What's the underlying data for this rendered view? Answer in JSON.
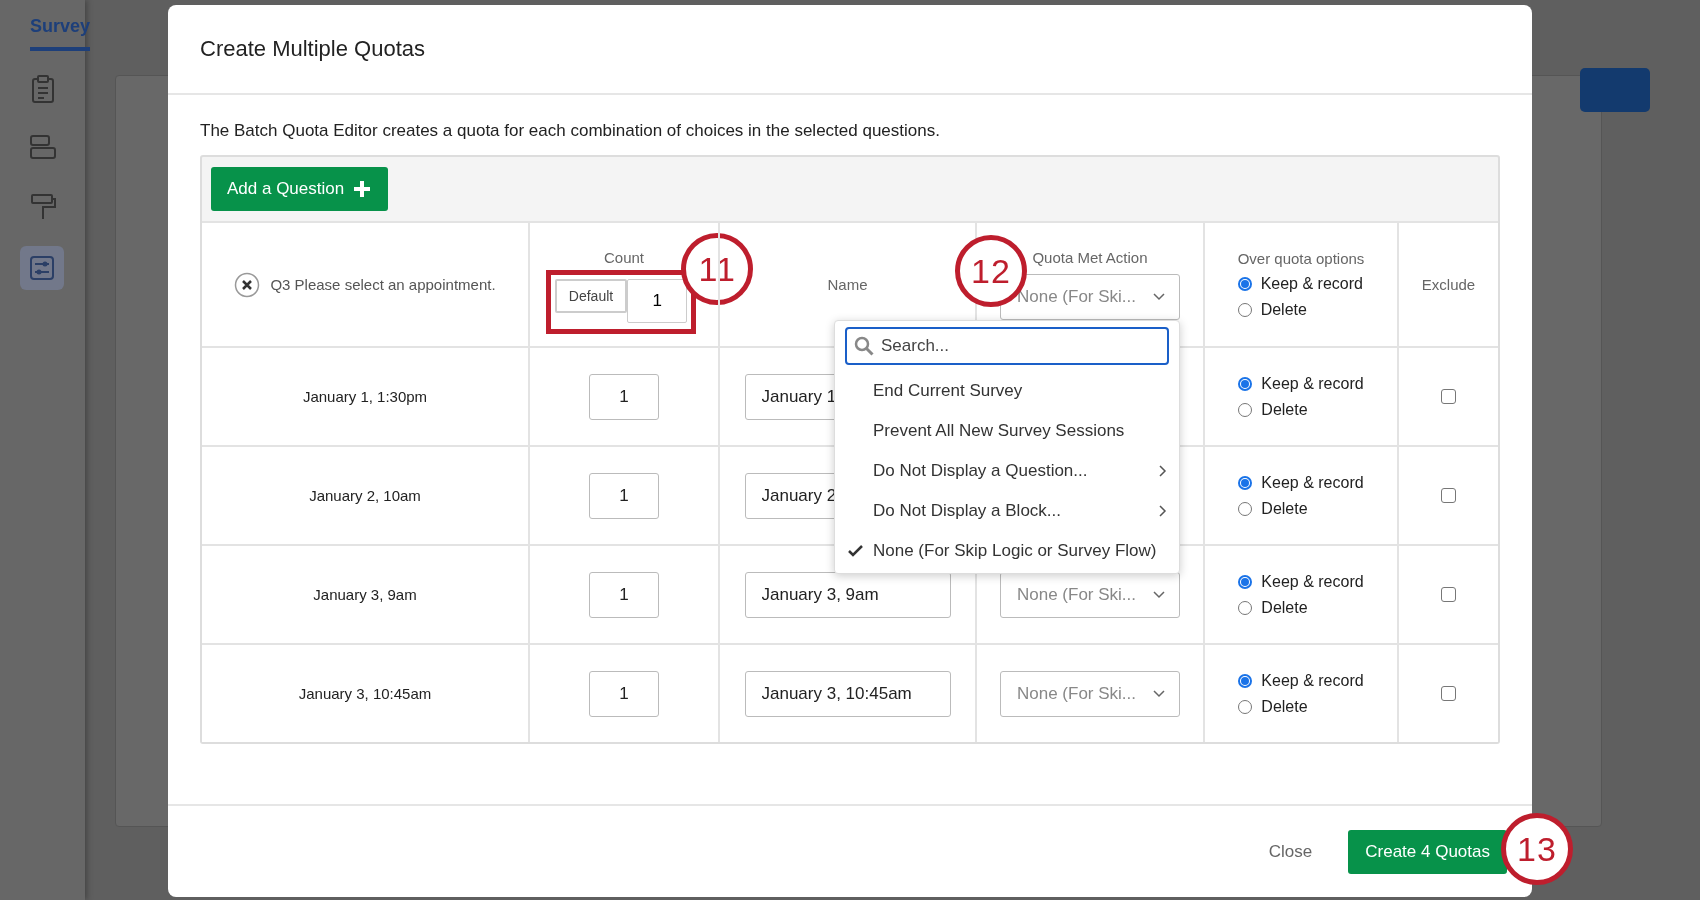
{
  "background": {
    "nav_tab": "Survey"
  },
  "dialog": {
    "title": "Create Multiple Quotas",
    "description": "The Batch Quota Editor creates a quota for each combination of choices in the selected questions.",
    "add_button": "Add a Question",
    "header": {
      "question": "Q3 Please select an appointment.",
      "count_label": "Count",
      "default_button": "Default",
      "default_count": "1",
      "count_callout": "11",
      "name_label": "Name",
      "action_label": "Quota Met Action",
      "action_value": "None (For Ski...",
      "action_callout": "12",
      "over_label": "Over quota options",
      "over_options": [
        {
          "label": "Keep & record",
          "selected": true
        },
        {
          "label": "Delete",
          "selected": false
        }
      ],
      "exclude_label": "Exclude"
    },
    "rows": [
      {
        "choice": "January 1, 1:30pm",
        "count": "1",
        "name": "January 1",
        "options": [
          {
            "label": "Keep & record",
            "selected": true
          },
          {
            "label": "Delete",
            "selected": false
          }
        ],
        "exclude": false
      },
      {
        "choice": "January 2, 10am",
        "count": "1",
        "name": "January 2",
        "options": [
          {
            "label": "Keep & record",
            "selected": true
          },
          {
            "label": "Delete",
            "selected": false
          }
        ],
        "exclude": false
      },
      {
        "choice": "January 3, 9am",
        "count": "1",
        "name": "January 3, 9am",
        "action": "None (For Ski...",
        "options": [
          {
            "label": "Keep & record",
            "selected": true
          },
          {
            "label": "Delete",
            "selected": false
          }
        ],
        "exclude": false
      },
      {
        "choice": "January 3, 10:45am",
        "count": "1",
        "name": "January 3, 10:45am",
        "action": "None (For Ski...",
        "options": [
          {
            "label": "Keep & record",
            "selected": true
          },
          {
            "label": "Delete",
            "selected": false
          }
        ],
        "exclude": false
      }
    ],
    "menu": {
      "placeholder": "Search...",
      "items": [
        {
          "label": "End Current Survey",
          "submenu": false,
          "selected": false
        },
        {
          "label": "Prevent All New Survey Sessions",
          "submenu": false,
          "selected": false
        },
        {
          "label": "Do Not Display a Question...",
          "submenu": true,
          "selected": false
        },
        {
          "label": "Do Not Display a Block...",
          "submenu": true,
          "selected": false
        },
        {
          "label": "None (For Skip Logic or Survey Flow)",
          "submenu": false,
          "selected": true
        }
      ]
    },
    "footer": {
      "close": "Close",
      "create": "Create 4 Quotas",
      "create_callout": "13"
    }
  }
}
